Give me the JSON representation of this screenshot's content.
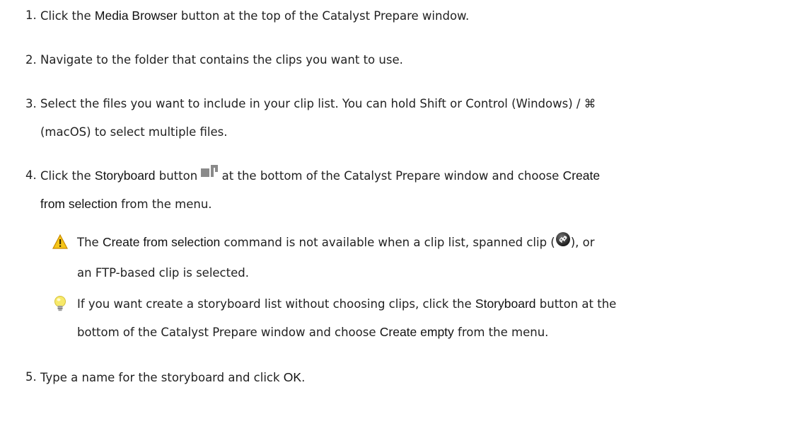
{
  "steps": [
    {
      "num": "1.",
      "pre": "Click the ",
      "bold": "Media Browser",
      "post": " button at the top of the Catalyst Prepare window."
    },
    {
      "num": "2.",
      "text": "Navigate to the folder that contains the clips you want to use."
    },
    {
      "num": "3.",
      "line1": "Select the files you want to include in your clip list. You can hold Shift or Control (Windows) / ⌘",
      "line2": "(macOS) to select multiple files."
    },
    {
      "num": "4.",
      "pre": "Click the ",
      "bold1": "Storyboard",
      "mid1": " button ",
      "icon": "storyboard-icon",
      "mid2": " at the bottom of the Catalyst Prepare window and choose ",
      "bold2a": "Create",
      "bold2b": "from selection",
      "post": " from the menu."
    },
    {
      "num": "5.",
      "pre": "Type a name for the storyboard and click ",
      "bold": "OK",
      "post": "."
    }
  ],
  "warning_note": {
    "icon": "warning-icon",
    "pre": "The ",
    "bold": "Create from selection",
    "mid": " command is not available when a clip list, spanned clip (",
    "inline_icon": "spanned-clip-icon",
    "post": "), or",
    "line2": "an FTP-based clip is selected."
  },
  "tip_note": {
    "icon": "lightbulb-icon",
    "pre": "If you want create a storyboard list without choosing clips, click the ",
    "bold1": "Storyboard",
    "mid": " button at the",
    "line2_pre": "bottom of the Catalyst Prepare window and choose ",
    "bold2": "Create empty",
    "line2_post": " from the menu."
  },
  "colors": {
    "text": "#222222",
    "warning_yellow": "#f5c518",
    "tip_yellow": "#f7e96a",
    "icon_gray": "#8a8a8a"
  }
}
